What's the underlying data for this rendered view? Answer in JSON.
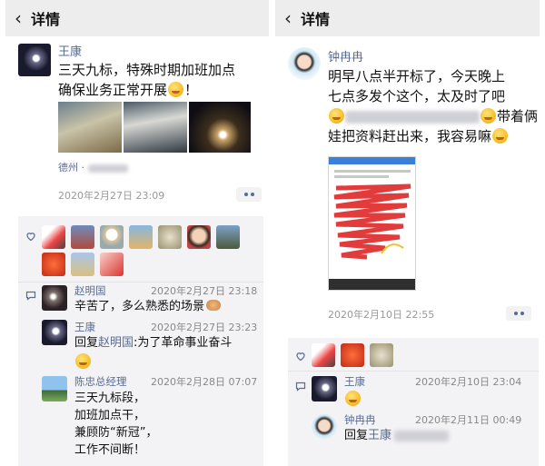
{
  "left": {
    "header": {
      "back_icon": "chevron-left-icon",
      "title": "详情"
    },
    "post": {
      "author": "王康",
      "text_line1": "三天九标，特殊时期加班加点",
      "text_line2": "确保业务正常开展",
      "text_tail": "！",
      "location": "德州 ·",
      "time": "2020年2月27日 23:09"
    },
    "comments": [
      {
        "name": "赵明国",
        "time": "2020年2月27日 23:18",
        "text": "辛苦了，多么熟悉的场景"
      },
      {
        "name": "王康",
        "time": "2020年2月27日 23:23",
        "reply_prefix": "回复",
        "reply_to": "赵明国",
        "text": ":为了革命事业奋斗"
      },
      {
        "name": "陈忠总经理",
        "time": "2020年2月28日 07:07",
        "lines": [
          "三天九标段，",
          "加班加点干，",
          "兼顾防“新冠”，",
          "工作不间断！"
        ]
      }
    ]
  },
  "right": {
    "header": {
      "back_icon": "chevron-left-icon",
      "title": "详情"
    },
    "post": {
      "author": "钟冉冉",
      "text_line1": "明早八点半开标了，今天晚上",
      "text_line2": "七点多发个这个，太及时了吧",
      "text_line3_tail": "带着俩",
      "text_line4": "娃把资料赶出来，我容易嘛",
      "time": "2020年2月10日 22:55"
    },
    "comments": [
      {
        "name": "王康",
        "time": "2020年2月10日 23:04"
      },
      {
        "name": "钟冉冉",
        "time": "2020年2月11日 00:49",
        "reply_prefix": "回复",
        "reply_to": "王康"
      }
    ]
  },
  "colors": {
    "link": "#576b95",
    "header_bg": "#ededed",
    "interact_bg": "#f3f3f5"
  }
}
